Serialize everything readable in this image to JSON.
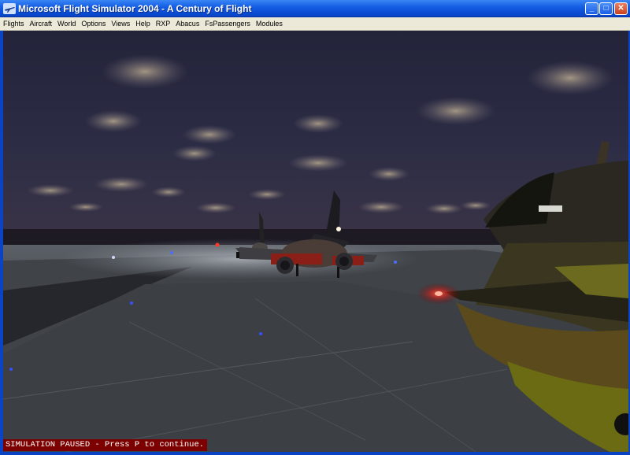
{
  "window": {
    "title": "Microsoft Flight Simulator 2004 - A Century of Flight",
    "controls": {
      "minimize": "_",
      "maximize": "□",
      "close": "✕"
    }
  },
  "menu": [
    "Flights",
    "Aircraft",
    "World",
    "Options",
    "Views",
    "Help",
    "RXP",
    "Abacus",
    "FsPassengers",
    "Modules"
  ],
  "status": {
    "message": "SIMULATION PAUSED - Press P to continue."
  },
  "colors": {
    "titlebar": "#0c4fd8",
    "menubar": "#ece9d8",
    "status_bg": "#7c0000",
    "sky": "#2a2c44",
    "apron": "#3b3e42"
  },
  "icons": [
    "app-plane-icon",
    "minimize-icon",
    "maximize-icon",
    "close-icon"
  ]
}
